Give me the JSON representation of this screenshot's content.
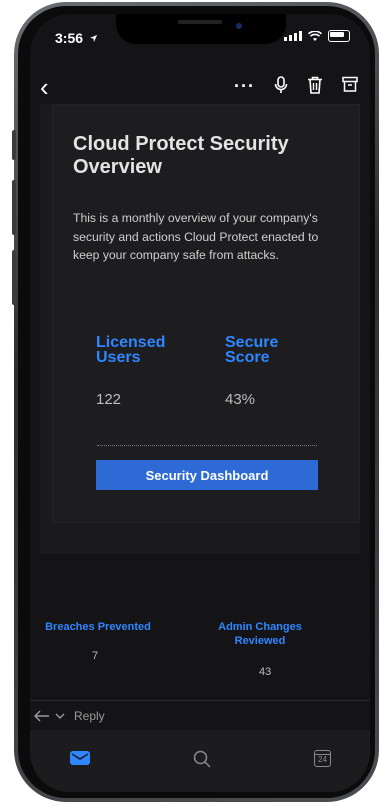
{
  "status": {
    "time": "3:56"
  },
  "email": {
    "title": "Cloud Protect Security Overview",
    "description": "This is a monthly overview of your company's security and actions Cloud Protect enacted to keep your company safe from attacks.",
    "stats": [
      {
        "label": "Licensed Users",
        "value": "122"
      },
      {
        "label": "Secure Score",
        "value": "43%"
      }
    ],
    "cta_label": "Security Dashboard",
    "footer_stats": [
      {
        "label": "Breaches Prevented",
        "value": "7"
      },
      {
        "label": "Admin Changes Reviewed",
        "value": "43"
      }
    ]
  },
  "reply": {
    "label": "Reply"
  },
  "tabs": {
    "calendar_day": "24"
  },
  "colors": {
    "accent": "#2f86ff",
    "button": "#2d6ad6",
    "background": "#141416"
  },
  "icons": [
    "back-icon",
    "more-icon",
    "microphone-icon",
    "trash-icon",
    "archive-icon",
    "reply-icon",
    "mail-icon",
    "search-icon",
    "calendar-icon"
  ]
}
